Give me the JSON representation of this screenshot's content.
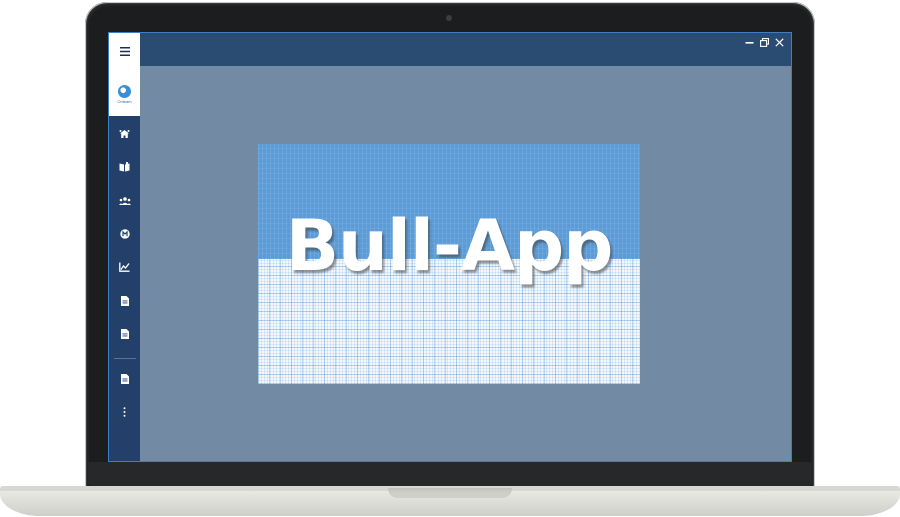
{
  "splash": {
    "title": "Bull-App"
  },
  "sidebar": {
    "logo_text": "Oriteam",
    "items": [
      {
        "icon": "home-network-icon"
      },
      {
        "icon": "book-icon"
      },
      {
        "icon": "users-icon"
      },
      {
        "icon": "circle-m-icon"
      },
      {
        "icon": "chart-icon"
      },
      {
        "icon": "document-icon"
      },
      {
        "icon": "document-icon"
      },
      {
        "icon": "document-icon"
      },
      {
        "icon": "more-vertical-icon"
      }
    ]
  },
  "window_controls": [
    "minimize-icon",
    "restore-icon",
    "close-icon"
  ],
  "colors": {
    "sidebar": "#23406a",
    "titlebar": "#2b4c72",
    "workspace": "#728aa3",
    "splash_header": "#5b9cd8"
  }
}
